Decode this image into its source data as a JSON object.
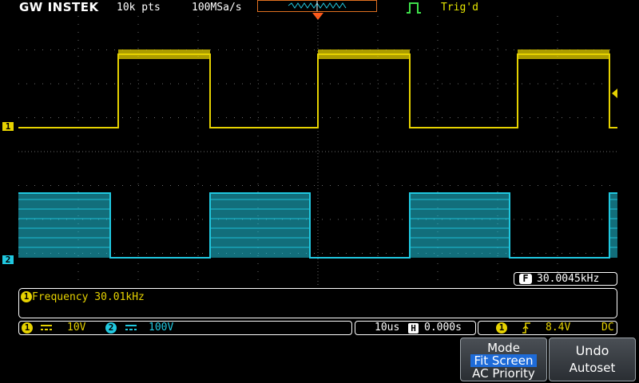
{
  "header": {
    "brand": "GW INSTEK",
    "record_length": "10k pts",
    "sample_rate": "100MSa/s",
    "trigger_status": "Trig'd",
    "trigger_icon": "edge-trigger-icon"
  },
  "channels": {
    "ch1": {
      "label": "1",
      "color": "#e6d200",
      "coupling_icon": "dc-coupling-icon",
      "scale": "10V"
    },
    "ch2": {
      "label": "2",
      "color": "#20c8e0",
      "coupling_icon": "dc-coupling-icon",
      "scale": "100V"
    }
  },
  "readout": {
    "badge": "F",
    "frequency": "30.0045kHz"
  },
  "measurement": {
    "channel": "1",
    "text": "Frequency 30.01kHz"
  },
  "timebase": {
    "scale": "10us",
    "badge": "H",
    "position": "0.000s"
  },
  "trigger": {
    "source": "1",
    "slope_icon": "rising-edge-icon",
    "level": "8.4V",
    "coupling": "DC"
  },
  "softkeys": {
    "mode": {
      "title": "Mode",
      "options": [
        "Fit Screen",
        "AC Priority"
      ],
      "selected": "Fit Screen"
    },
    "undo": {
      "line1": "Undo",
      "line2": "Autoset"
    }
  }
}
